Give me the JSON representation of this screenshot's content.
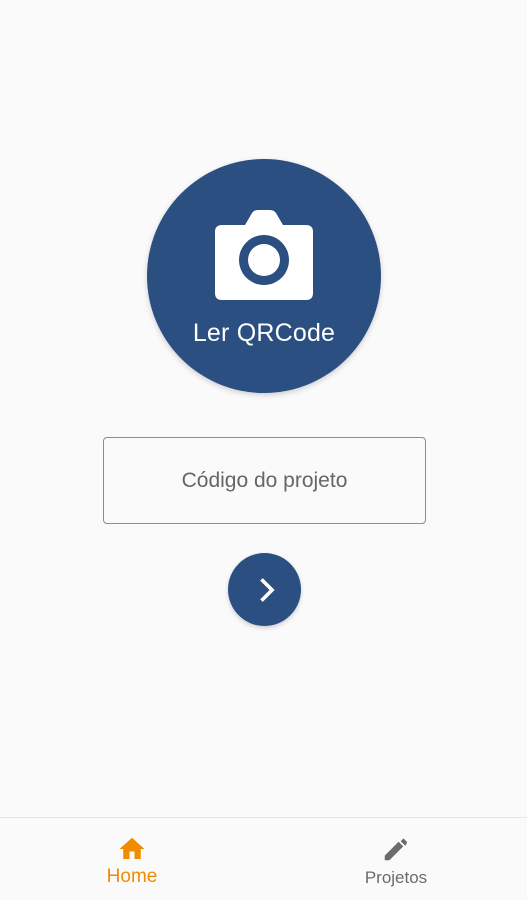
{
  "scan": {
    "label": "Ler QRCode",
    "icon": "camera-icon",
    "color": "#2a4f80"
  },
  "code_input": {
    "placeholder": "Código do projeto",
    "value": ""
  },
  "submit": {
    "icon": "chevron-right-icon",
    "color": "#2a4f80"
  },
  "bottom_nav": {
    "active_color": "#f08c00",
    "inactive_color": "#6b6b6b",
    "items": [
      {
        "label": "Home",
        "icon": "home-icon",
        "active": true
      },
      {
        "label": "Projetos",
        "icon": "pencil-icon",
        "active": false
      }
    ]
  }
}
